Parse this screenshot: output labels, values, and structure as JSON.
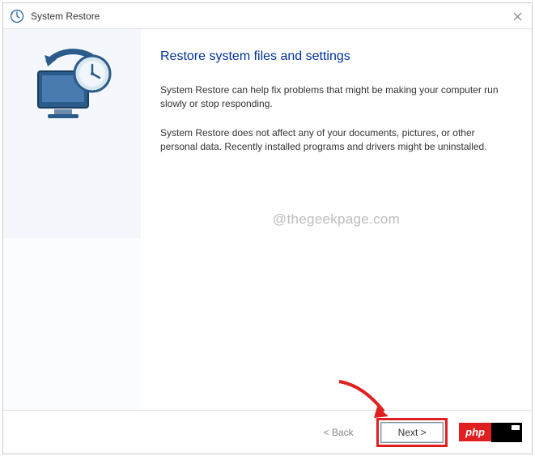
{
  "titlebar": {
    "icon_name": "system-restore-icon",
    "title": "System Restore"
  },
  "sidebar": {
    "illustration_name": "monitor-clock-restore-icon"
  },
  "main": {
    "heading": "Restore system files and settings",
    "paragraph1": "System Restore can help fix problems that might be making your computer run slowly or stop responding.",
    "paragraph2": "System Restore does not affect any of your documents, pictures, or other personal data. Recently installed programs and drivers might be uninstalled."
  },
  "watermark": "@thegeekpage.com",
  "buttons": {
    "back": "< Back",
    "next": "Next >"
  },
  "badge": {
    "text": "php"
  }
}
